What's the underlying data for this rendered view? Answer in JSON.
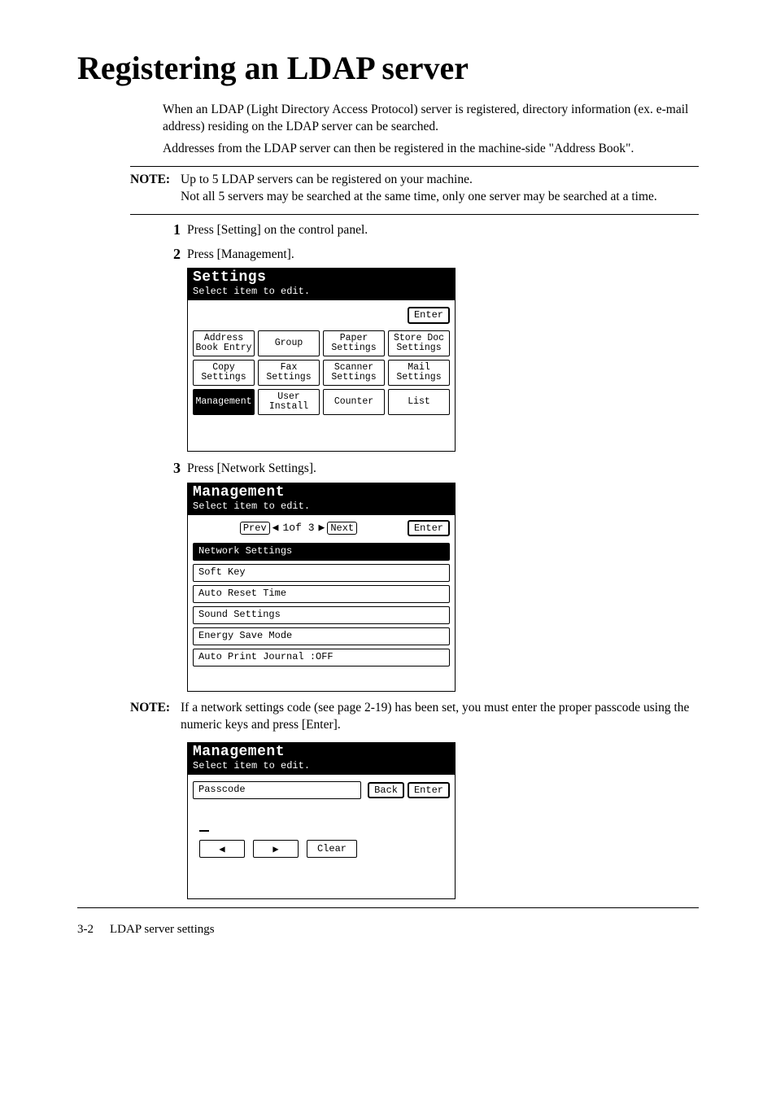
{
  "title": "Registering an LDAP server",
  "intro": {
    "p1": "When an LDAP (Light Directory Access Protocol) server is registered, directory information (ex. e-mail address) residing on the LDAP server can be searched.",
    "p2": "Addresses from the LDAP server can then be registered in the machine-side \"Address Book\"."
  },
  "note1": {
    "label": "NOTE:",
    "line1": "Up to 5 LDAP servers can be registered on your machine.",
    "line2": "Not all 5 servers may be searched at the same time, only one server may be searched at a time."
  },
  "steps": {
    "s1": {
      "num": "1",
      "text": "Press [Setting] on the control panel."
    },
    "s2": {
      "num": "2",
      "text": "Press [Management]."
    },
    "s3": {
      "num": "3",
      "text": "Press [Network Settings]."
    }
  },
  "lcd_settings": {
    "title": "Settings",
    "sub": "Select item to edit.",
    "enter": "Enter",
    "grid": [
      "Address\nBook Entry",
      "Group",
      "Paper\nSettings",
      "Store Doc\nSettings",
      "Copy\nSettings",
      "Fax\nSettings",
      "Scanner\nSettings",
      "Mail\nSettings",
      "Management",
      "User\nInstall",
      "Counter",
      "List"
    ],
    "selected_index": 8
  },
  "lcd_management": {
    "title": "Management",
    "sub": "Select item to edit.",
    "prev": "Prev",
    "next": "Next",
    "enter": "Enter",
    "page_indicator": "1of 3",
    "left_arrow": "◀",
    "right_arrow": "▶",
    "items": [
      "Network Settings",
      "Soft Key",
      "Auto Reset Time",
      "Sound Settings",
      "Energy Save Mode",
      "Auto Print Journal  :OFF"
    ],
    "selected_index": 0
  },
  "note2": {
    "label": "NOTE:",
    "text": "If a network settings code (see page 2-19) has been set, you must enter the proper passcode using the numeric keys and press [Enter]."
  },
  "lcd_passcode": {
    "title": "Management",
    "sub": "Select item to edit.",
    "label": "Passcode",
    "back": "Back",
    "enter": "Enter",
    "clear": "Clear",
    "left_arrow": "◀",
    "right_arrow": "▶"
  },
  "footer": {
    "page": "3-2",
    "section": "LDAP server settings"
  }
}
